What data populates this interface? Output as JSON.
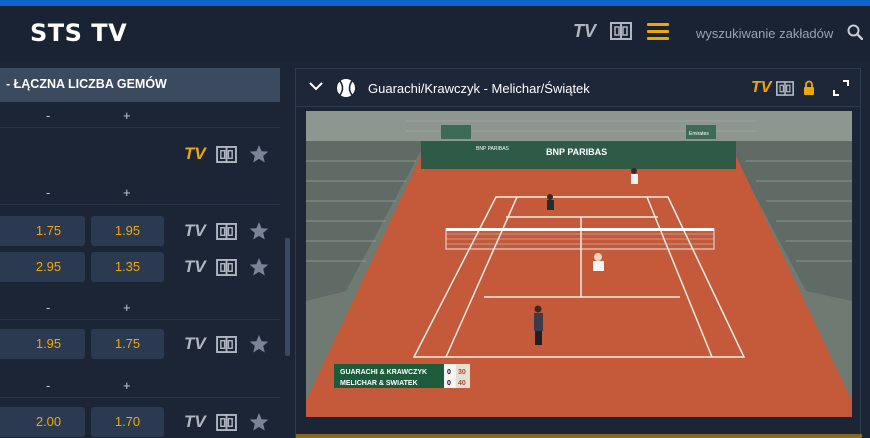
{
  "header": {
    "brand": "STS TV",
    "tv_label": "TV",
    "search_placeholder": "wyszukiwanie zakładów"
  },
  "left_panel": {
    "market_title": "- ŁĄCZNA LICZBA GEMÓW",
    "minus_label": "-",
    "plus_label": "+",
    "tv_label": "TV",
    "groups": [
      {
        "rows": []
      },
      {
        "rows": [
          {
            "odds": [
              "1.75",
              "1.95"
            ]
          },
          {
            "odds": [
              "2.95",
              "1.35"
            ]
          }
        ]
      },
      {
        "rows": [
          {
            "odds": [
              "1.95",
              "1.75"
            ]
          }
        ]
      },
      {
        "rows": [
          {
            "odds": [
              "2.00",
              "1.70"
            ]
          }
        ]
      }
    ]
  },
  "stream": {
    "match_title": "Guarachi/Krawczyk - Melichar/Świątek",
    "tv_label": "TV",
    "scoreboard": {
      "team1": "GUARACHI & KRAWCZYK",
      "team2": "MELICHAR & SWIATEK",
      "team1_games": "0",
      "team2_games": "0",
      "team1_points": "30",
      "team2_points": "40"
    },
    "sponsor": "BNP PARIBAS",
    "sponsor2": "BNP PARIBAS",
    "clock_brand": "Emirates"
  },
  "colors": {
    "accent": "#f0a800",
    "top_border": "#0c66c9",
    "background": "#1b2536",
    "odds_button": "#2b3a51",
    "clay": "#c55a3a"
  },
  "icons": [
    "search-icon",
    "court-icon",
    "menu-icon",
    "star-icon",
    "chevron-down-icon",
    "tennis-ball-icon",
    "lock-icon",
    "expand-icon"
  ]
}
